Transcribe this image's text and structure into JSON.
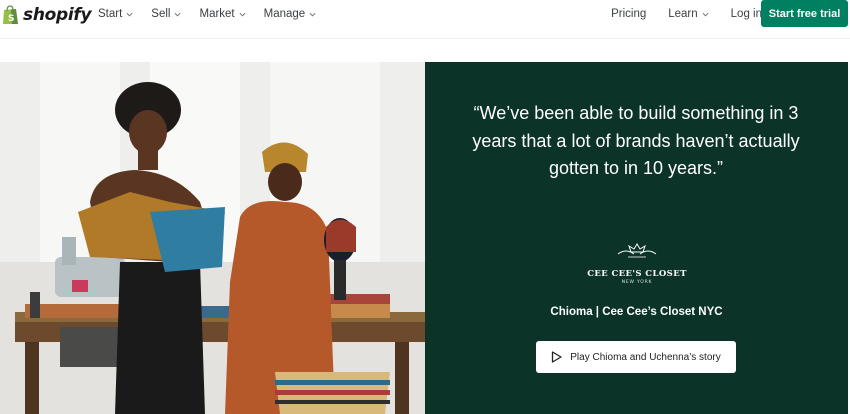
{
  "header": {
    "logo_text": "shopify",
    "nav_left": [
      {
        "label": "Start"
      },
      {
        "label": "Sell"
      },
      {
        "label": "Market"
      },
      {
        "label": "Manage"
      }
    ],
    "nav_right": {
      "pricing": "Pricing",
      "learn": "Learn",
      "login": "Log in"
    },
    "cta_label": "Start free trial"
  },
  "testimonial": {
    "quote": "“We’ve been able to build something in 3 years that a lot of brands haven’t actually gotten to in 10 years.”",
    "brand_name": "CEE CEE'S CLOSET",
    "brand_location": "NEW YORK",
    "attribution": "Chioma | Cee Cee’s Closet NYC",
    "play_label": "Play Chioma and Uchenna’s story"
  },
  "colors": {
    "brand_green": "#008060",
    "panel_green": "#0b3328"
  }
}
